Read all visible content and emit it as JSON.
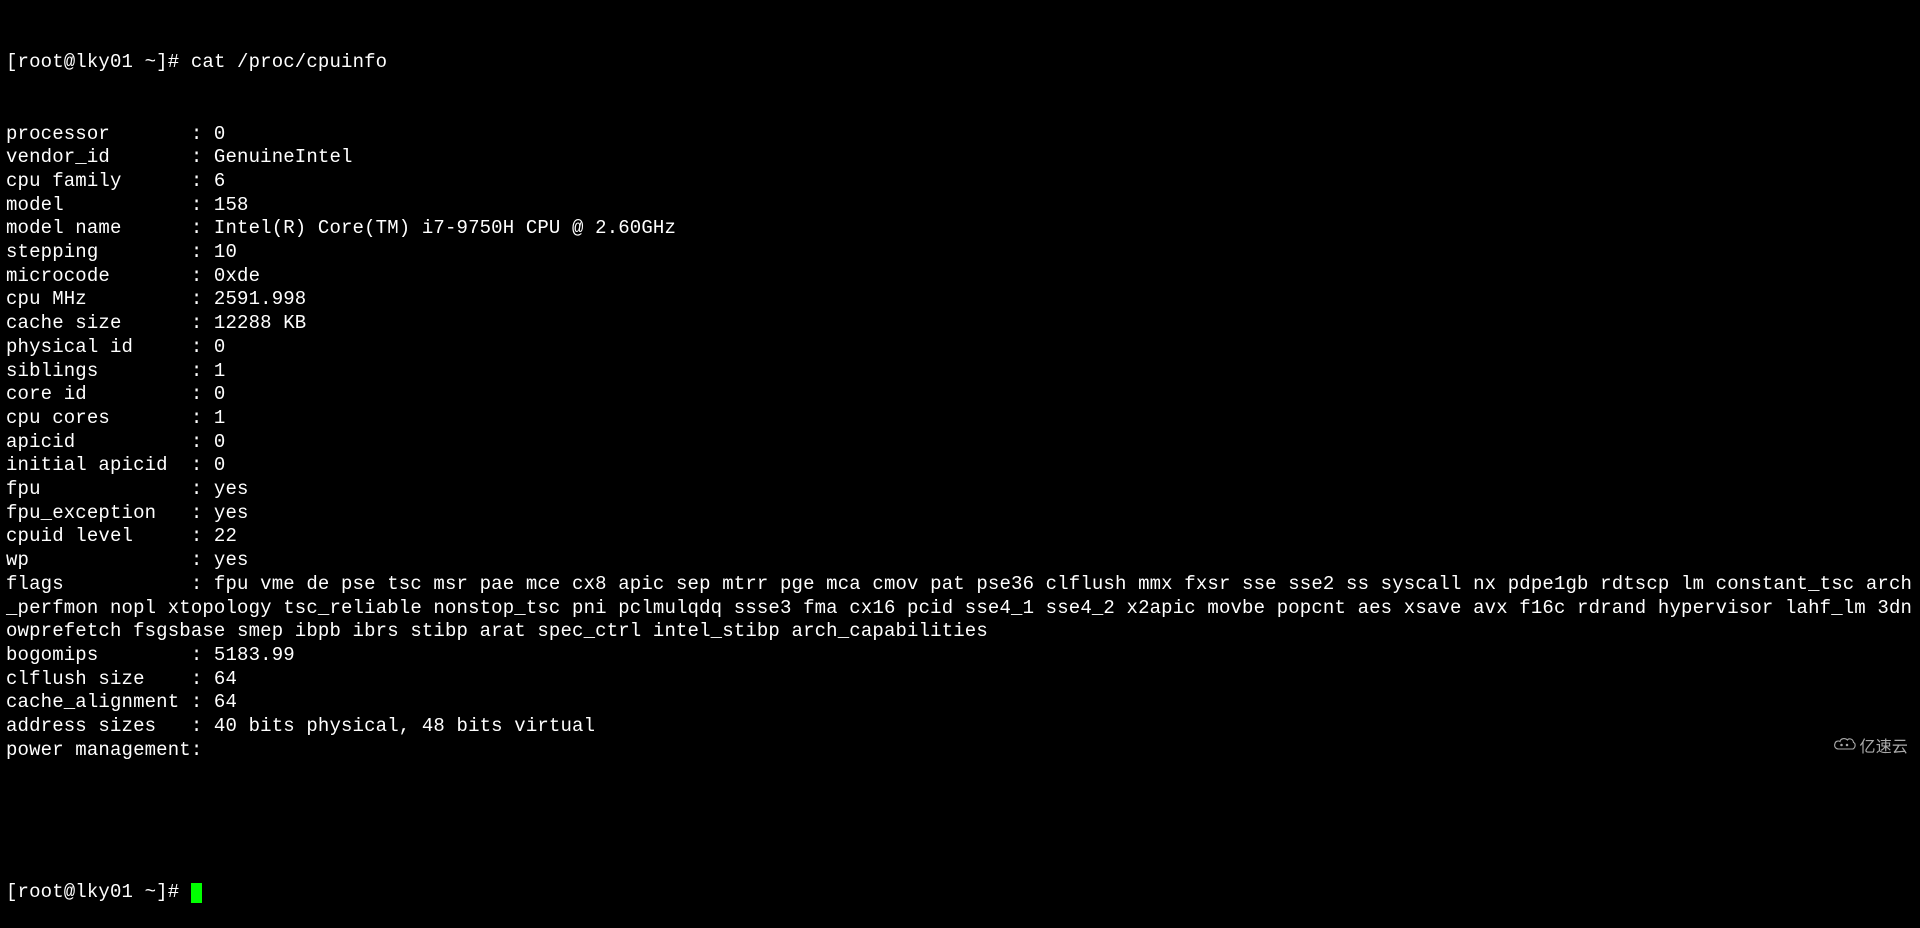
{
  "prompt1": "[root@lky01 ~]# ",
  "command": "cat /proc/cpuinfo",
  "prompt2": "[root@lky01 ~]# ",
  "watermark_text": "亿速云",
  "cpuinfo": {
    "processor": {
      "label": "processor",
      "value": "0"
    },
    "vendor_id": {
      "label": "vendor_id",
      "value": "GenuineIntel"
    },
    "cpu_family": {
      "label": "cpu family",
      "value": "6"
    },
    "model": {
      "label": "model",
      "value": "158"
    },
    "model_name": {
      "label": "model name",
      "value": "Intel(R) Core(TM) i7-9750H CPU @ 2.60GHz"
    },
    "stepping": {
      "label": "stepping",
      "value": "10"
    },
    "microcode": {
      "label": "microcode",
      "value": "0xde"
    },
    "cpu_mhz": {
      "label": "cpu MHz",
      "value": "2591.998"
    },
    "cache_size": {
      "label": "cache size",
      "value": "12288 KB"
    },
    "physical_id": {
      "label": "physical id",
      "value": "0"
    },
    "siblings": {
      "label": "siblings",
      "value": "1"
    },
    "core_id": {
      "label": "core id",
      "value": "0"
    },
    "cpu_cores": {
      "label": "cpu cores",
      "value": "1"
    },
    "apicid": {
      "label": "apicid",
      "value": "0"
    },
    "initial_apicid": {
      "label": "initial apicid",
      "value": "0"
    },
    "fpu": {
      "label": "fpu",
      "value": "yes"
    },
    "fpu_exception": {
      "label": "fpu_exception",
      "value": "yes"
    },
    "cpuid_level": {
      "label": "cpuid level",
      "value": "22"
    },
    "wp": {
      "label": "wp",
      "value": "yes"
    },
    "flags": {
      "label": "flags",
      "value": "fpu vme de pse tsc msr pae mce cx8 apic sep mtrr pge mca cmov pat pse36 clflush mmx fxsr sse sse2 ss syscall nx pdpe1gb rdtscp lm constant_tsc arch_perfmon nopl xtopology tsc_reliable nonstop_tsc pni pclmulqdq ssse3 fma cx16 pcid sse4_1 sse4_2 x2apic movbe popcnt aes xsave avx f16c rdrand hypervisor lahf_lm 3dnowprefetch fsgsbase smep ibpb ibrs stibp arat spec_ctrl intel_stibp arch_capabilities"
    },
    "bogomips": {
      "label": "bogomips",
      "value": "5183.99"
    },
    "clflush_size": {
      "label": "clflush size",
      "value": "64"
    },
    "cache_alignment": {
      "label": "cache_alignment",
      "value": "64"
    },
    "address_sizes": {
      "label": "address sizes",
      "value": "40 bits physical, 48 bits virtual"
    },
    "power_management": {
      "label": "power management",
      "value": ""
    }
  },
  "field_order": [
    "processor",
    "vendor_id",
    "cpu_family",
    "model",
    "model_name",
    "stepping",
    "microcode",
    "cpu_mhz",
    "cache_size",
    "physical_id",
    "siblings",
    "core_id",
    "cpu_cores",
    "apicid",
    "initial_apicid",
    "fpu",
    "fpu_exception",
    "cpuid_level",
    "wp",
    "flags",
    "bogomips",
    "clflush_size",
    "cache_alignment",
    "address_sizes",
    "power_management"
  ],
  "label_pad_width": 16
}
